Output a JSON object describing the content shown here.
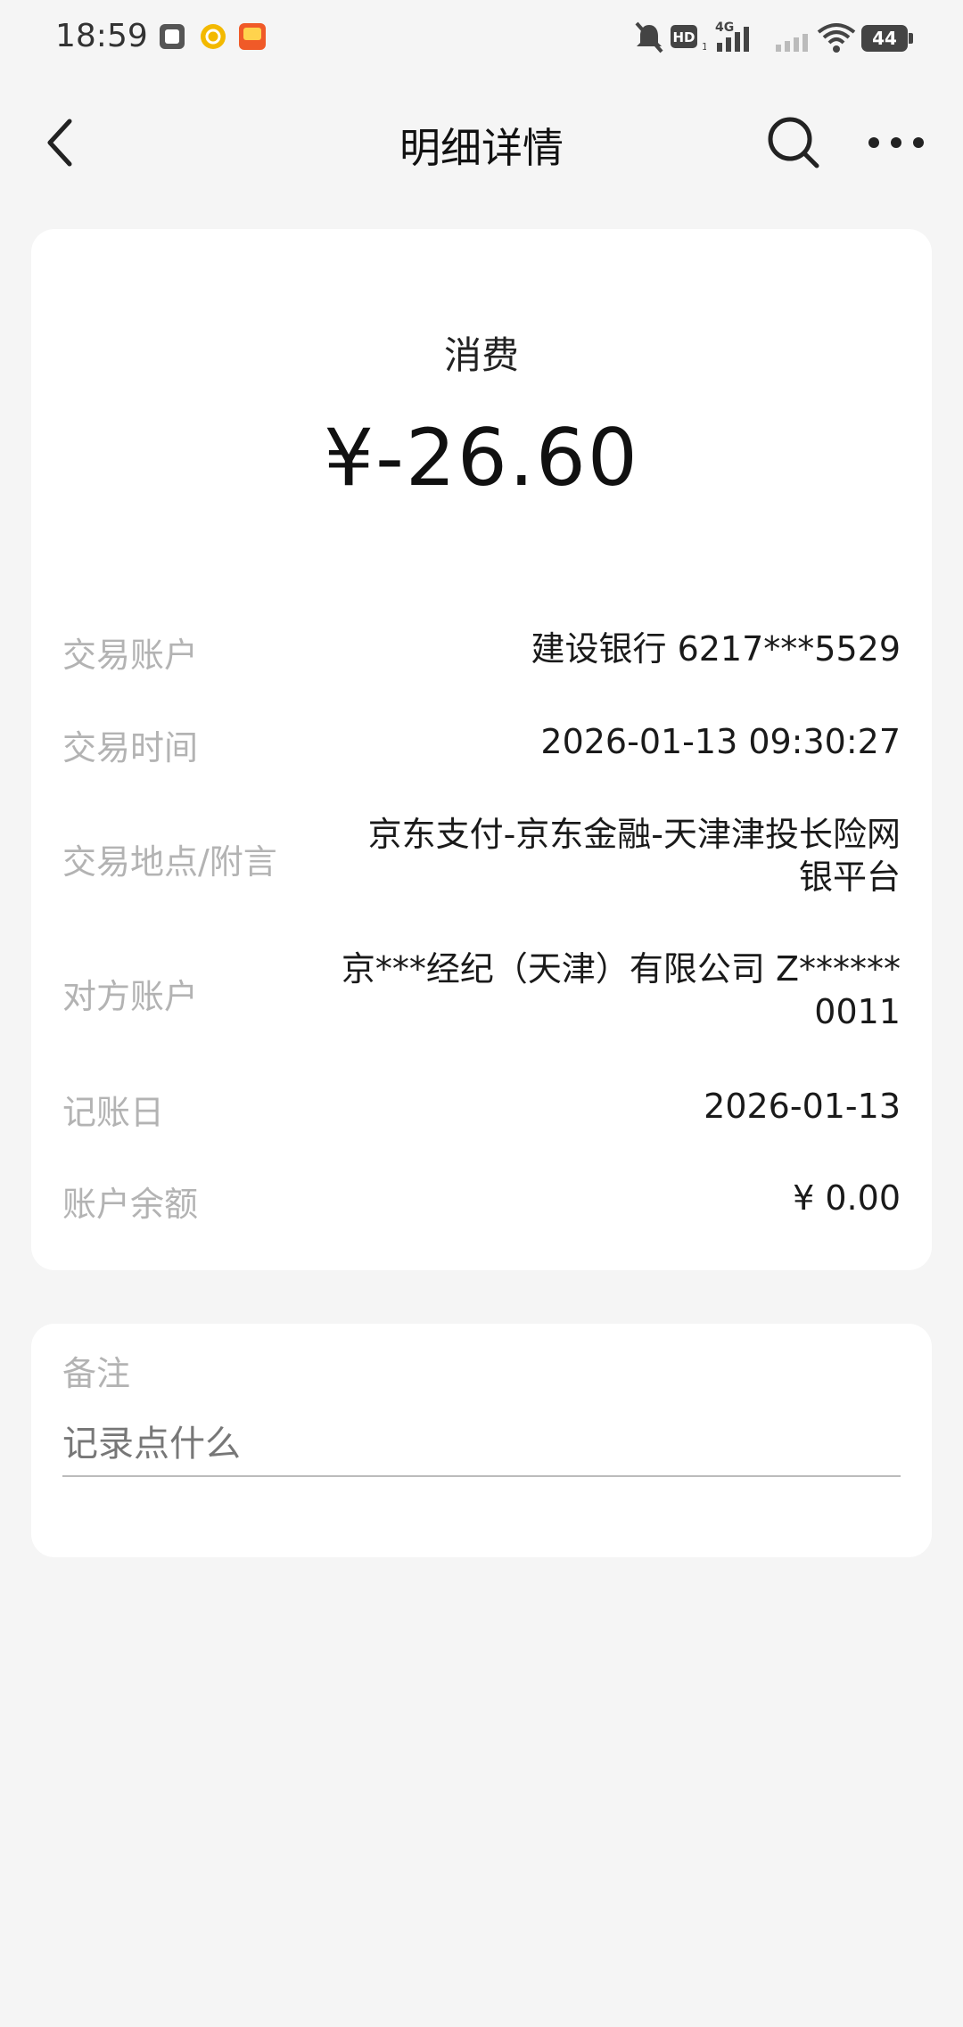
{
  "status_bar": {
    "time": "18:59",
    "battery": "44",
    "network": "4G",
    "hd_label": "HD"
  },
  "header": {
    "title": "明细详情"
  },
  "summary": {
    "type": "消费",
    "amount": "¥-26.60"
  },
  "details": [
    {
      "label": "交易账户",
      "value": "建设银行 6217***5529"
    },
    {
      "label": "交易时间",
      "value": "2026-01-13 09:30:27"
    },
    {
      "label": "交易地点/附言",
      "value": "京东支付-京东金融-天津津投长险网",
      "value2": "银平台"
    },
    {
      "label": "对方账户",
      "value": "京***经纪（天津）有限公司 Z******",
      "value2": "0011"
    },
    {
      "label": "记账日",
      "value": "2026-01-13"
    },
    {
      "label": "账户余额",
      "value": "¥ 0.00"
    }
  ],
  "note": {
    "label": "备注",
    "placeholder": "记录点什么"
  },
  "icons": {
    "back": "back-arrow-icon",
    "search": "search-icon",
    "more": "more-icon"
  }
}
